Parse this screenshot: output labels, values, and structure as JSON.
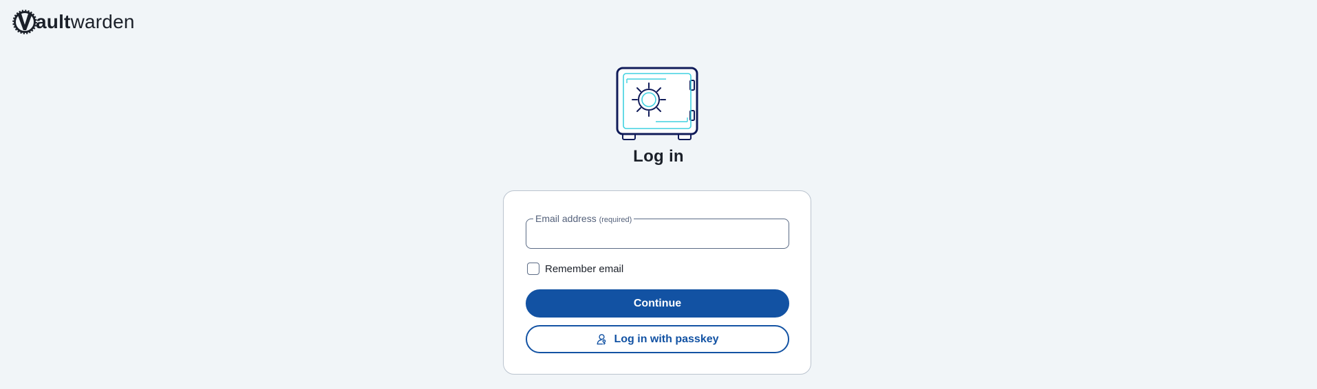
{
  "brand": {
    "logo_letter": "V",
    "name_bold": "ault",
    "name_regular": "warden"
  },
  "page": {
    "title": "Log in"
  },
  "form": {
    "email_label": "Email address",
    "email_required": "(required)",
    "email_value": "",
    "remember_label": "Remember email",
    "remember_checked": false,
    "continue_label": "Continue",
    "passkey_label": "Log in with passkey"
  },
  "colors": {
    "background": "#f1f5f8",
    "primary": "#1252a3",
    "vault_outline": "#101b59",
    "vault_accent": "#3fd1e0"
  },
  "icons": {
    "logo": "vaultwarden-logo-icon",
    "illustration": "vault-safe-icon",
    "passkey": "passkey-user-icon"
  }
}
